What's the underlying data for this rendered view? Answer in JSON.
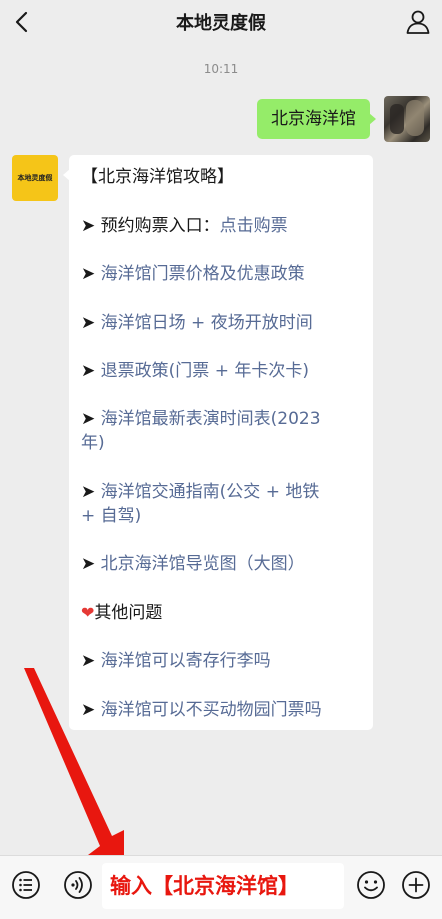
{
  "header": {
    "title": "本地灵度假"
  },
  "chat": {
    "time": "10:11",
    "my_message": "北京海洋馆",
    "bot_avatar_text": "本地灵度假",
    "bot_message": {
      "heading": "【北京海洋馆攻略】",
      "arrow": "➤",
      "item0_prefix": "预约购票入口：",
      "item0_link": "点击购票",
      "item1": "海洋馆门票价格及优惠政策",
      "item2": "海洋馆日场 + 夜场开放时间",
      "item3": "退票政策(门票 + 年卡次卡)",
      "item4_a": "海洋馆最新表演时间表(2023",
      "item4_b": "年)",
      "item5_a": "海洋馆交通指南(公交 + 地铁",
      "item5_b": "+ 自驾)",
      "item6": "北京海洋馆导览图（大图）",
      "heart": "❤",
      "other_label": "其他问题",
      "item7": "海洋馆可以寄存行李吗",
      "item8": "海洋馆可以不买动物园门票吗"
    }
  },
  "bottom": {
    "input_text": "输入【北京海洋馆】"
  },
  "colors": {
    "my_bubble": "#95ec69",
    "link": "#576b95",
    "annotation_red": "#e8170f",
    "background": "#ededed"
  },
  "icons": [
    "chevron-left-icon",
    "person-icon",
    "menu-list-icon",
    "voice-icon",
    "emoji-icon",
    "plus-icon"
  ]
}
